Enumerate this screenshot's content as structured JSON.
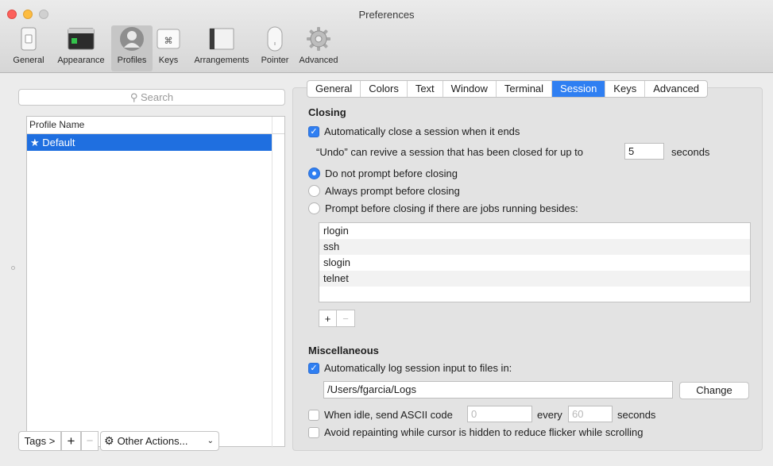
{
  "window": {
    "title": "Preferences"
  },
  "toolbar": {
    "items": [
      {
        "label": "General",
        "icon": "general-switch-icon"
      },
      {
        "label": "Appearance",
        "icon": "terminal-window-icon"
      },
      {
        "label": "Profiles",
        "icon": "user-silhouette-icon",
        "selected": true
      },
      {
        "label": "Keys",
        "icon": "command-key-icon",
        "glyph": "⌘"
      },
      {
        "label": "Arrangements",
        "icon": "window-arrangement-icon"
      },
      {
        "label": "Pointer",
        "icon": "mouse-icon"
      },
      {
        "label": "Advanced",
        "icon": "gear-icon"
      }
    ]
  },
  "left": {
    "search_placeholder": "Search",
    "table_header": "Profile Name",
    "profiles": [
      {
        "label": "★ Default",
        "selected": true
      }
    ],
    "bottom": {
      "tags": "Tags >",
      "plus": "+",
      "minus": "−",
      "actions": "Other Actions...",
      "actions_icon": "gear-icon",
      "chevron": "⌄"
    }
  },
  "tabs": [
    {
      "label": "General"
    },
    {
      "label": "Colors"
    },
    {
      "label": "Text"
    },
    {
      "label": "Window"
    },
    {
      "label": "Terminal"
    },
    {
      "label": "Session",
      "selected": true
    },
    {
      "label": "Keys"
    },
    {
      "label": "Advanced"
    }
  ],
  "closing": {
    "heading": "Closing",
    "auto_close": {
      "label": "Automatically close a session when it ends",
      "checked": true
    },
    "undo_text": "“Undo” can revive a session that has been closed for up to",
    "undo_value": "5",
    "undo_unit": "seconds",
    "radio_options": [
      {
        "label": "Do not prompt before closing",
        "checked": true
      },
      {
        "label": "Always prompt before closing",
        "checked": false
      },
      {
        "label": "Prompt before closing if there are jobs running besides:",
        "checked": false
      }
    ],
    "jobs": [
      "rlogin",
      "ssh",
      "slogin",
      "telnet"
    ],
    "add": "+",
    "remove": "−"
  },
  "misc": {
    "heading": "Miscellaneous",
    "log_input": {
      "label": "Automatically log session input to files in:",
      "checked": true
    },
    "log_path": "/Users/fgarcia/Logs",
    "change_button": "Change",
    "idle": {
      "label": "When idle, send ASCII code",
      "checked": false,
      "code_placeholder": "0",
      "every": "every",
      "seconds_placeholder": "60",
      "unit": "seconds"
    },
    "avoid_repaint": {
      "label": "Avoid repainting while cursor is hidden to reduce flicker while scrolling",
      "checked": false
    }
  },
  "colors": {
    "accent": "#2f7ff2",
    "selection": "#1f6fe0"
  }
}
